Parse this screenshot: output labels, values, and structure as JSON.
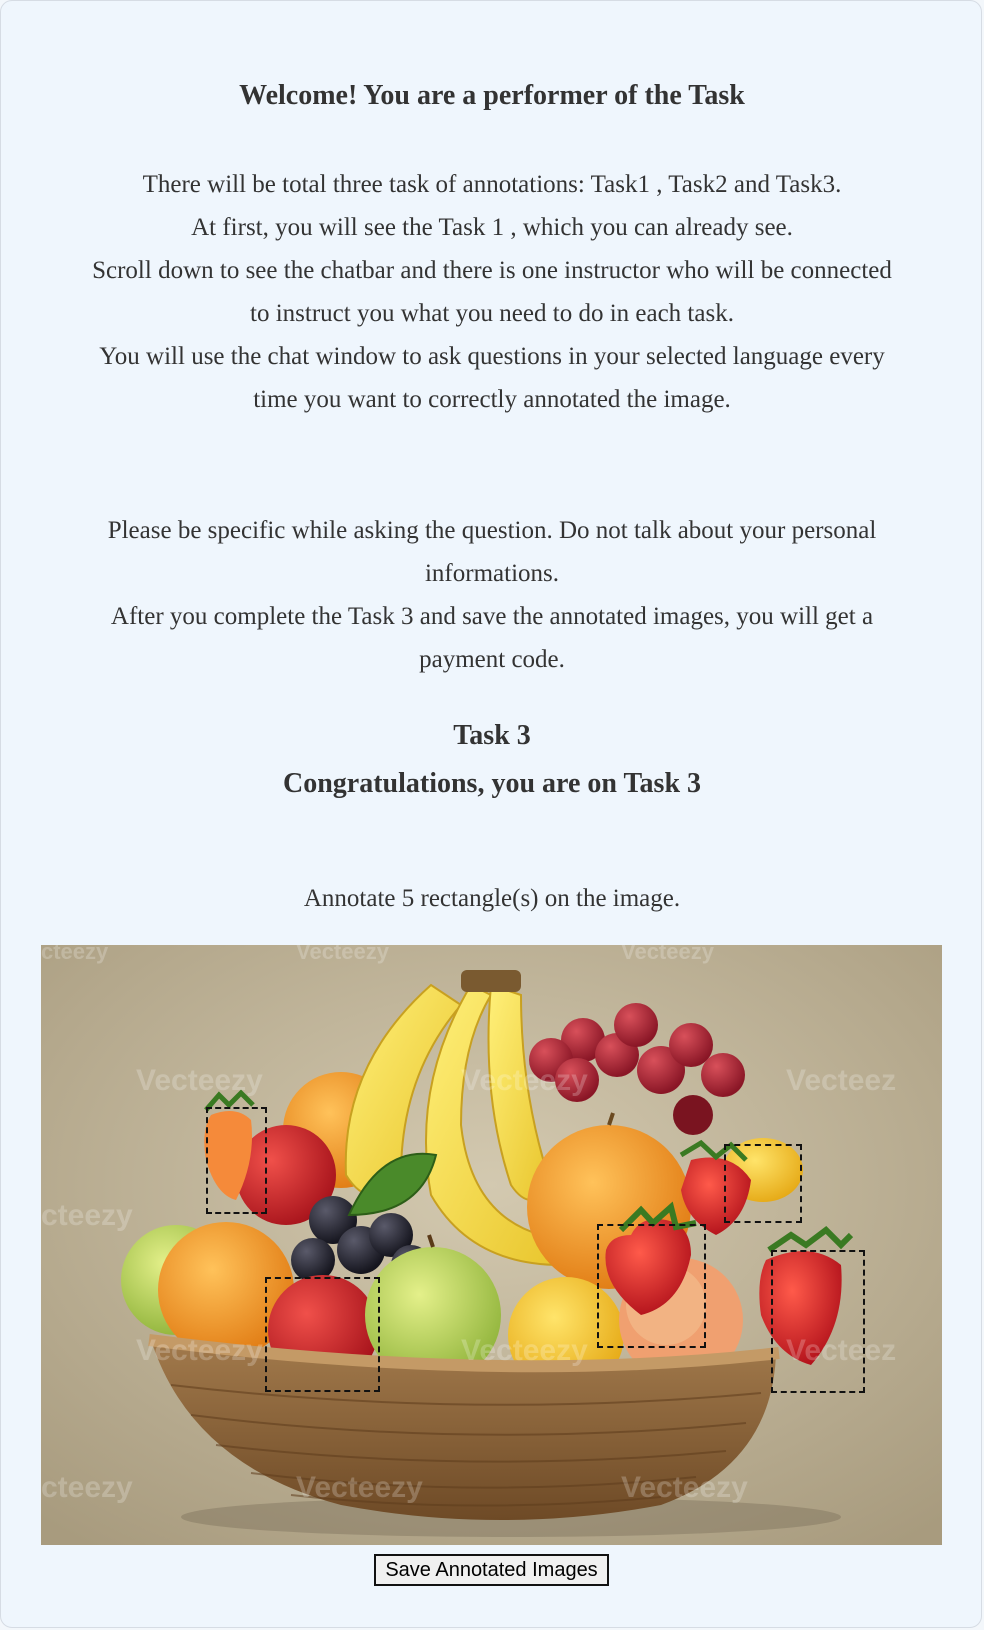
{
  "header": {
    "title": "Welcome! You are a performer of the Task"
  },
  "intro": {
    "lines": [
      "There will be total three task of annotations: Task1 , Task2 and Task3.",
      "At first, you will see the Task 1 , which you can already see.",
      "Scroll down to see the chatbar and there is one instructor who will be connected",
      "to instruct you what you need to do in each task.",
      "You will use the chat window to ask questions in your selected language every",
      "time you want to correctly annotated the image."
    ]
  },
  "notes": {
    "lines": [
      "Please be specific while asking the question. Do not talk about your personal",
      "informations.",
      "After you complete the Task 3 and save the annotated images, you will get a",
      "payment code."
    ]
  },
  "task": {
    "title": "Task 3",
    "congrats": "Congratulations, you are on Task 3",
    "instruction": "Annotate 5 rectangle(s) on the image."
  },
  "image": {
    "watermark_text": "Vecteezy",
    "annotation_count": 5
  },
  "actions": {
    "save_label": "Save Annotated Images"
  }
}
